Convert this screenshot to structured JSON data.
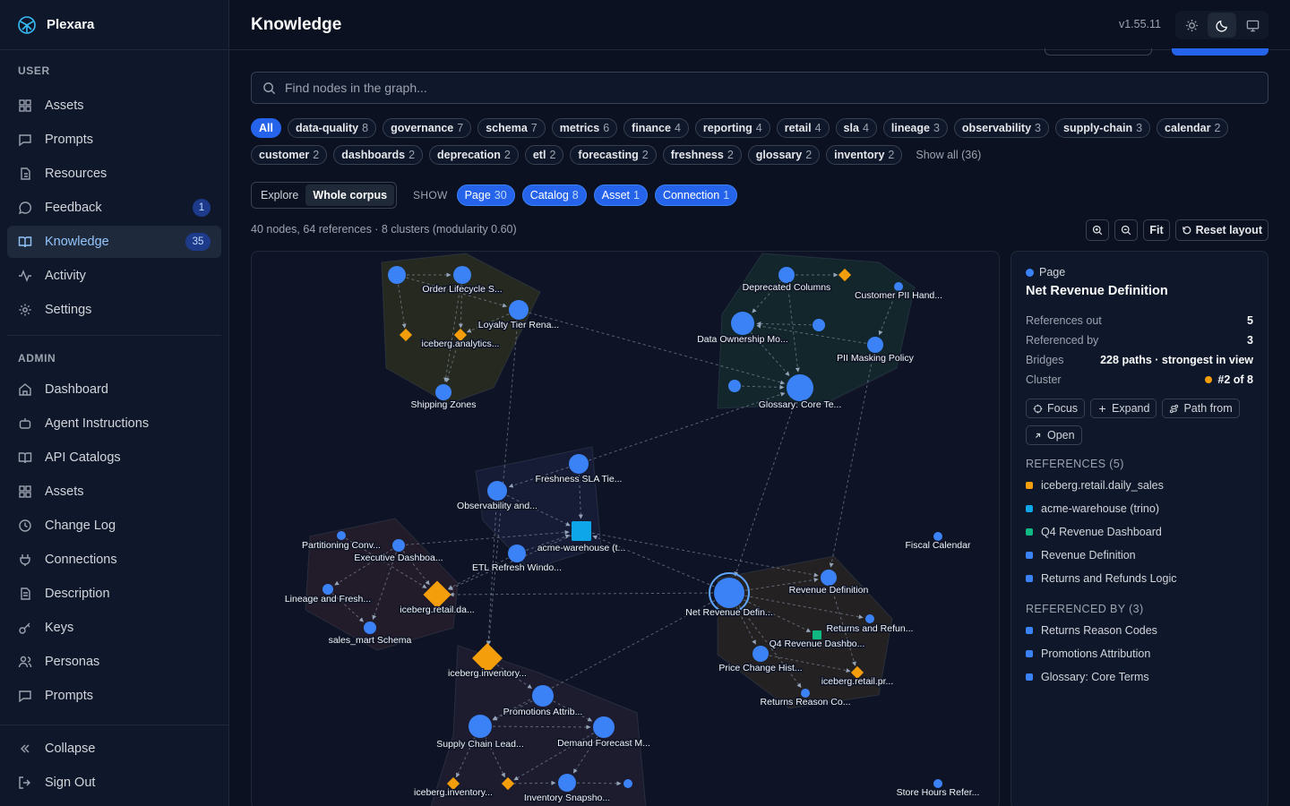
{
  "brand": {
    "name": "Plexara"
  },
  "sidebar": {
    "user_label": "USER",
    "user_items": [
      {
        "label": "Assets",
        "icon": "grid-icon"
      },
      {
        "label": "Prompts",
        "icon": "message-square-icon"
      },
      {
        "label": "Resources",
        "icon": "file-icon"
      },
      {
        "label": "Feedback",
        "icon": "message-circle-icon",
        "badge": "1"
      },
      {
        "label": "Knowledge",
        "icon": "book-open-icon",
        "badge": "35",
        "active": true
      },
      {
        "label": "Activity",
        "icon": "activity-icon"
      },
      {
        "label": "Settings",
        "icon": "gear-icon"
      }
    ],
    "admin_label": "ADMIN",
    "admin_items": [
      {
        "label": "Dashboard",
        "icon": "home-icon"
      },
      {
        "label": "Agent Instructions",
        "icon": "bot-icon"
      },
      {
        "label": "API Catalogs",
        "icon": "book-icon"
      },
      {
        "label": "Assets",
        "icon": "grid-icon"
      },
      {
        "label": "Change Log",
        "icon": "clock-icon"
      },
      {
        "label": "Connections",
        "icon": "plug-icon"
      },
      {
        "label": "Description",
        "icon": "document-icon"
      },
      {
        "label": "Keys",
        "icon": "key-icon"
      },
      {
        "label": "Personas",
        "icon": "users-icon"
      },
      {
        "label": "Prompts",
        "icon": "message-square-icon"
      }
    ],
    "collapse_label": "Collapse",
    "signout_label": "Sign Out"
  },
  "header": {
    "title": "Knowledge",
    "version": "v1.55.11"
  },
  "search": {
    "placeholder": "Find nodes in the graph..."
  },
  "tags": [
    {
      "label": "All",
      "count": "",
      "active": true
    },
    {
      "label": "data-quality",
      "count": "8"
    },
    {
      "label": "governance",
      "count": "7"
    },
    {
      "label": "schema",
      "count": "7"
    },
    {
      "label": "metrics",
      "count": "6"
    },
    {
      "label": "finance",
      "count": "4"
    },
    {
      "label": "reporting",
      "count": "4"
    },
    {
      "label": "retail",
      "count": "4"
    },
    {
      "label": "sla",
      "count": "4"
    },
    {
      "label": "lineage",
      "count": "3"
    },
    {
      "label": "observability",
      "count": "3"
    },
    {
      "label": "supply-chain",
      "count": "3"
    },
    {
      "label": "calendar",
      "count": "2"
    },
    {
      "label": "customer",
      "count": "2"
    },
    {
      "label": "dashboards",
      "count": "2"
    },
    {
      "label": "deprecation",
      "count": "2"
    },
    {
      "label": "etl",
      "count": "2"
    },
    {
      "label": "forecasting",
      "count": "2"
    },
    {
      "label": "freshness",
      "count": "2"
    },
    {
      "label": "glossary",
      "count": "2"
    },
    {
      "label": "inventory",
      "count": "2"
    }
  ],
  "show_all_label": "Show all (36)",
  "view": {
    "explore_label": "Explore",
    "corpus_label": "Whole corpus",
    "show_label": "SHOW"
  },
  "filters": [
    {
      "label": "Page",
      "count": "30"
    },
    {
      "label": "Catalog",
      "count": "8"
    },
    {
      "label": "Asset",
      "count": "1"
    },
    {
      "label": "Connection",
      "count": "1"
    }
  ],
  "stats": "40 nodes, 64 references · 8 clusters (modularity 0.60)",
  "tools": {
    "fit_label": "Fit",
    "reset_label": "Reset layout"
  },
  "colors": {
    "page": "#3b82f6",
    "catalog": "#f59e0b",
    "asset": "#10b981",
    "connection": "#0ea5e9",
    "accent": "#2563eb"
  },
  "graph_labels": {
    "order_lifecycle": "Order Lifecycle S...",
    "loyalty": "Loyalty Tier Rena...",
    "iceberg_analytics": "iceberg.analytics...",
    "shipping": "Shipping Zones",
    "deprecated": "Deprecated Columns",
    "customer_pii": "Customer PII Hand...",
    "data_ownership": "Data Ownership Mo...",
    "pii_masking": "PII Masking Policy",
    "glossary": "Glossary: Core Te...",
    "freshness": "Freshness SLA Tie...",
    "observability": "Observability and...",
    "acme_warehouse": "acme-warehouse (t...",
    "etl_refresh": "ETL Refresh Windo...",
    "partitioning": "Partitioning Conv...",
    "exec_dash": "Executive Dashboa...",
    "lineage": "Lineage and Fresh...",
    "iceberg_retail_da": "iceberg.retail.da...",
    "sales_mart": "sales_mart Schema",
    "fiscal": "Fiscal Calendar",
    "revenue_def": "Revenue Definition",
    "net_revenue": "Net Revenue Defin...",
    "returns_refun": "Returns and Refun...",
    "q4_dash": "Q4 Revenue Dashbo...",
    "price_change": "Price Change Hist...",
    "iceberg_retail_pr": "iceberg.retail.pr...",
    "returns_reason": "Returns Reason Co...",
    "iceberg_inventory": "iceberg.inventory...",
    "promotions": "Promotions Attrib...",
    "supply_chain": "Supply Chain Lead...",
    "demand": "Demand Forecast M...",
    "iceberg_inventory2": "iceberg.inventory...",
    "inventory_snap": "Inventory Snapsho...",
    "store_hours": "Store Hours Refer..."
  },
  "panel": {
    "type": "Page",
    "title": "Net Revenue Definition",
    "rows": [
      {
        "label": "References out",
        "value": "5"
      },
      {
        "label": "Referenced by",
        "value": "3"
      },
      {
        "label": "Bridges",
        "value": "228 paths · strongest in view"
      },
      {
        "label": "Cluster",
        "value": "#2 of 8"
      }
    ],
    "actions": [
      "Focus",
      "Expand",
      "Path from",
      "Open"
    ],
    "references_label": "REFERENCES (5)",
    "references": [
      {
        "label": "iceberg.retail.daily_sales",
        "color": "#f59e0b"
      },
      {
        "label": "acme-warehouse (trino)",
        "color": "#0ea5e9"
      },
      {
        "label": "Q4 Revenue Dashboard",
        "color": "#10b981"
      },
      {
        "label": "Revenue Definition",
        "color": "#3b82f6"
      },
      {
        "label": "Returns and Refunds Logic",
        "color": "#3b82f6"
      }
    ],
    "referenced_by_label": "REFERENCED BY (3)",
    "referenced_by": [
      {
        "label": "Returns Reason Codes",
        "color": "#3b82f6"
      },
      {
        "label": "Promotions Attribution",
        "color": "#3b82f6"
      },
      {
        "label": "Glossary: Core Terms",
        "color": "#3b82f6"
      }
    ]
  }
}
